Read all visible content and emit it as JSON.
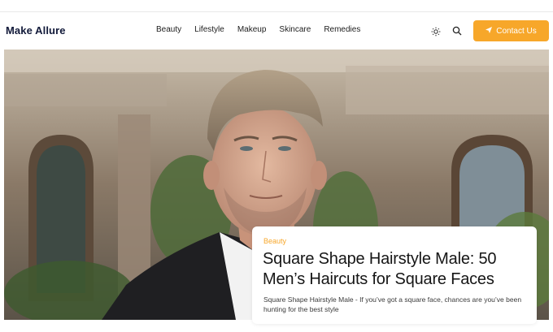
{
  "header": {
    "logo": "Make Allure",
    "nav": [
      "Beauty",
      "Lifestyle",
      "Makeup",
      "Skincare",
      "Remedies"
    ],
    "contact_label": "Contact Us"
  },
  "icons": {
    "theme_toggle": "sun-icon",
    "search": "search-icon",
    "contact": "send-icon"
  },
  "featured": {
    "category": "Beauty",
    "title": "Square Shape Hairstyle Male: 50 Men’s Haircuts for Square Faces",
    "excerpt": "Square Shape Hairstyle Male - If you’ve got a square face, chances are you’ve been hunting for the best style"
  },
  "colors": {
    "accent": "#f7a72a",
    "logo": "#121a3a"
  }
}
